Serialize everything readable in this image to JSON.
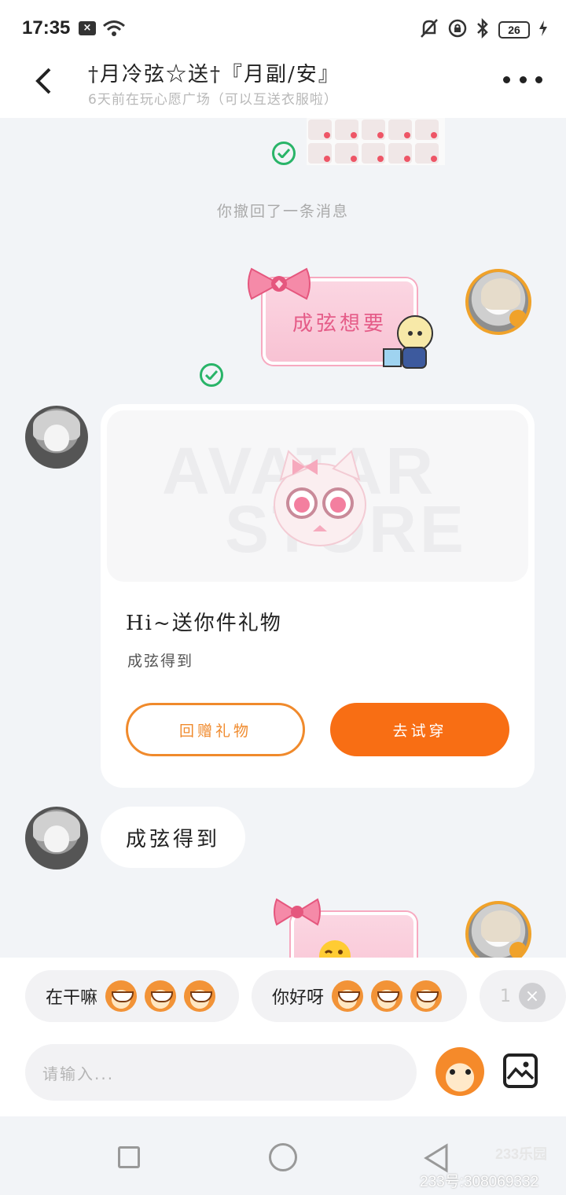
{
  "status_bar": {
    "time": "17:35",
    "x_badge": "×",
    "battery": "26"
  },
  "header": {
    "title": "†月冷弦☆送†『月副/安』",
    "subtitle": "6天前在玩心愿广场（可以互送衣服啦）"
  },
  "chat": {
    "system_message": "你撤回了一条消息",
    "sticker1_text": "成弦想要",
    "gift_card": {
      "watermark_line1": "AVATAR",
      "watermark_line2": "STORE",
      "title": "Hi~送你件礼物",
      "description": "成弦得到",
      "return_gift_label": "回赠礼物",
      "try_on_label": "去试穿"
    },
    "text_message": "成弦得到"
  },
  "quick_replies": [
    {
      "label": "在干嘛"
    },
    {
      "label": "你好呀"
    },
    {
      "label": "1"
    }
  ],
  "composer": {
    "placeholder": "请输入..."
  },
  "watermark": {
    "logo": "233乐园",
    "id_text": "233号:308069332"
  },
  "colors": {
    "accent": "#f86e14",
    "check": "#29b468",
    "sticker_pink": "#f8c2d3"
  }
}
